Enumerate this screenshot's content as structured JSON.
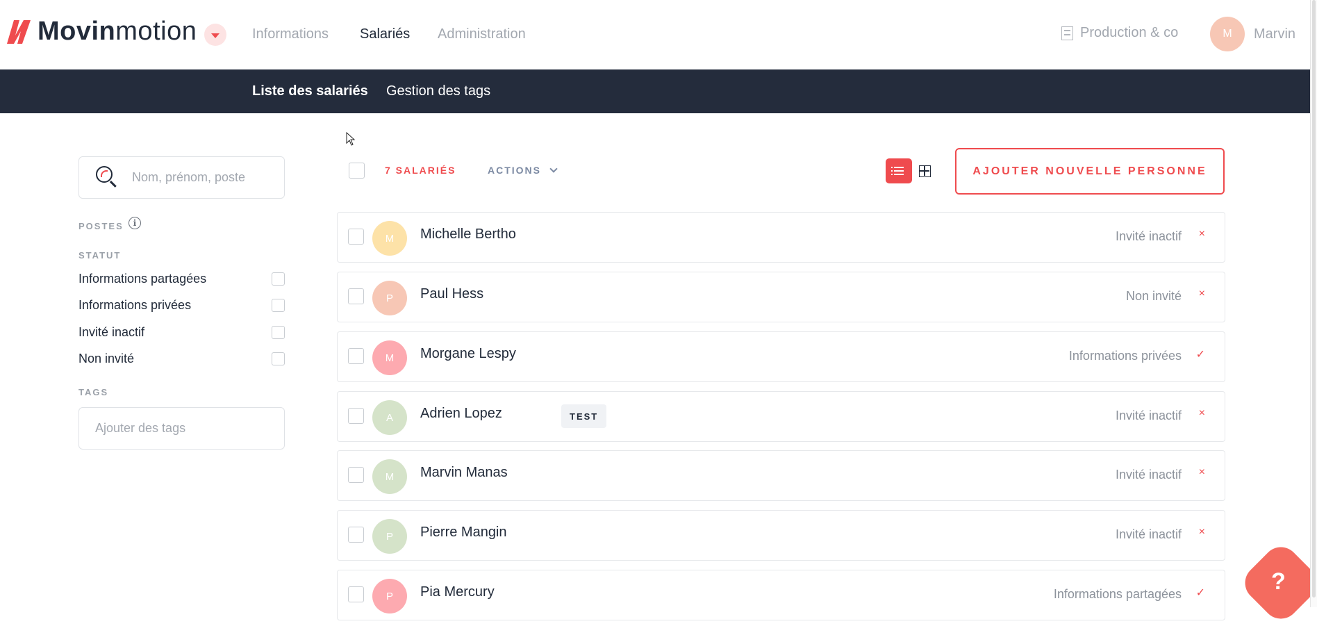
{
  "app": {
    "logo_bold": "Movin",
    "logo_light": "motion"
  },
  "topnav": [
    {
      "label": "Informations",
      "active": false
    },
    {
      "label": "Salariés",
      "active": true
    },
    {
      "label": "Administration",
      "active": false
    }
  ],
  "company": {
    "name": "Production & co",
    "icon": "building-icon"
  },
  "user": {
    "initial": "M",
    "name": "Marvin"
  },
  "subnav": [
    {
      "label": "Liste des salariés",
      "active": true
    },
    {
      "label": "Gestion des tags",
      "active": false
    }
  ],
  "filters": {
    "search_placeholder": "Nom, prénom, poste",
    "postes_label": "POSTES",
    "statut_label": "STATUT",
    "statut_options": [
      "Informations partagées",
      "Informations privées",
      "Invité inactif",
      "Non invité"
    ],
    "tags_label": "TAGS",
    "tags_placeholder": "Ajouter des tags"
  },
  "toolbar": {
    "count_label": "7 SALARIÉS",
    "actions_label": "ACTIONS",
    "add_button_label": "AJOUTER NOUVELLE PERSONNE"
  },
  "employees": [
    {
      "initial": "M",
      "name": "Michelle Bertho",
      "status": "Invité inactif",
      "mark": "×",
      "avatar_color": "#fde2a8",
      "tag": ""
    },
    {
      "initial": "P",
      "name": "Paul Hess",
      "status": "Non invité",
      "mark": "×",
      "avatar_color": "#f7c7b5",
      "tag": ""
    },
    {
      "initial": "M",
      "name": "Morgane Lespy",
      "status": "Informations privées",
      "mark": "✓",
      "avatar_color": "#fdaab0",
      "tag": ""
    },
    {
      "initial": "A",
      "name": "Adrien Lopez",
      "status": "Invité inactif",
      "mark": "×",
      "avatar_color": "#d5e3c9",
      "tag": "TEST"
    },
    {
      "initial": "M",
      "name": "Marvin Manas",
      "status": "Invité inactif",
      "mark": "×",
      "avatar_color": "#d5e3c9",
      "tag": ""
    },
    {
      "initial": "P",
      "name": "Pierre Mangin",
      "status": "Invité inactif",
      "mark": "×",
      "avatar_color": "#d5e3c9",
      "tag": ""
    },
    {
      "initial": "P",
      "name": "Pia Mercury",
      "status": "Informations partagées",
      "mark": "✓",
      "avatar_color": "#fdaab0",
      "tag": ""
    }
  ],
  "help": {
    "label": "?"
  },
  "colors": {
    "accent": "#ef4b4e",
    "navy": "#242c3c"
  }
}
